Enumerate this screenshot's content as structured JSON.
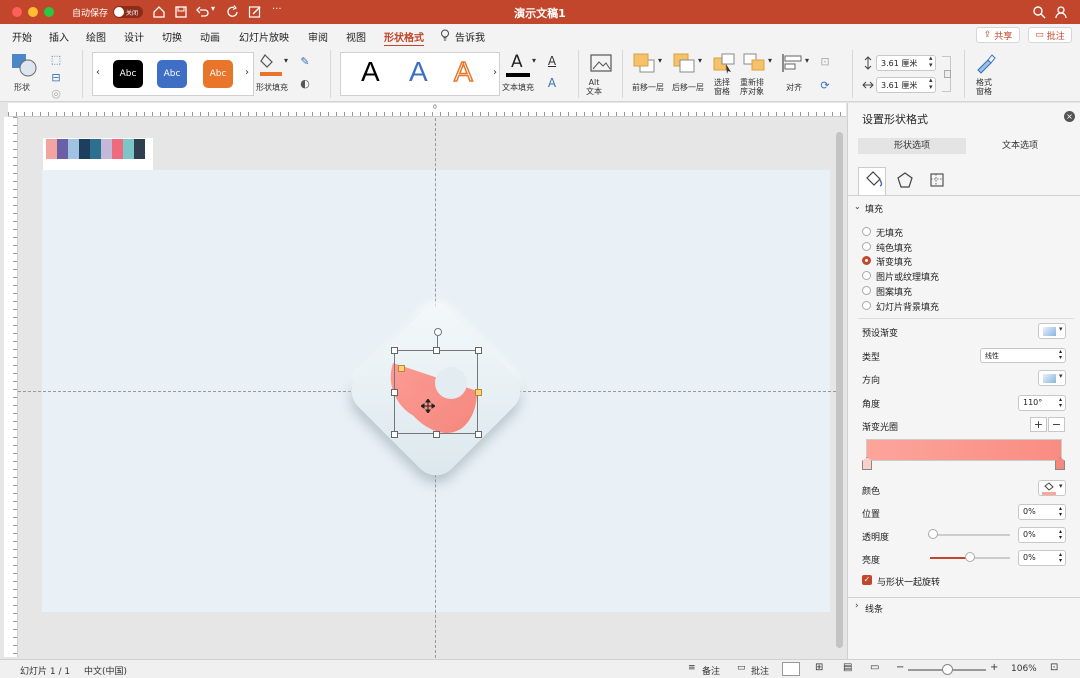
{
  "titlebar": {
    "autosave_label": "自动保存",
    "toggle_label": "关闭",
    "title": "演示文稿1"
  },
  "tabs": [
    "开始",
    "插入",
    "绘图",
    "设计",
    "切换",
    "动画",
    "幻灯片放映",
    "审阅",
    "视图",
    "形状格式",
    "告诉我"
  ],
  "active_tab": "形状格式",
  "share": {
    "share_label": "共享",
    "comments_label": "批注"
  },
  "ribbon": {
    "shapes_label": "形状",
    "style_samples": [
      "Abc",
      "Abc",
      "Abc"
    ],
    "shape_fill_label": "形状填充",
    "wordart_samples": [
      "A",
      "A",
      "A"
    ],
    "text_fill_label": "文本填充",
    "alt_text_label": "Alt\n文本",
    "bring_forward_label": "前移一层",
    "send_backward_label": "后移一层",
    "selection_pane_label": "选择\n窗格",
    "reorder_label": "重新排\n序对象",
    "align_label": "对齐",
    "height_value": "3.61 厘米",
    "width_value": "3.61 厘米",
    "format_pane_label": "格式\n窗格"
  },
  "panel": {
    "title": "设置形状格式",
    "tab_shape": "形状选项",
    "tab_text": "文本选项",
    "fill_section": "填充",
    "fill_options": [
      "无填充",
      "纯色填充",
      "渐变填充",
      "图片或纹理填充",
      "图案填充",
      "幻灯片背景填充"
    ],
    "selected_fill": "渐变填充",
    "preset_label": "预设渐变",
    "type_label": "类型",
    "type_value": "线性",
    "direction_label": "方向",
    "angle_label": "角度",
    "angle_value": "110°",
    "stops_label": "渐变光圈",
    "color_label": "颜色",
    "position_label": "位置",
    "position_value": "0%",
    "transparency_label": "透明度",
    "transparency_value": "0%",
    "brightness_label": "亮度",
    "brightness_value": "0%",
    "rotate_with_shape_label": "与形状一起旋转",
    "line_section": "线条"
  },
  "status": {
    "slide_label": "幻灯片 1 / 1",
    "language": "中文(中国)",
    "notes_label": "备注",
    "comments_label": "批注",
    "zoom": "106%"
  },
  "colors": {
    "accent": "#c2462b",
    "coral": "#f8a097",
    "slide_bg": "#e9f1f6",
    "palette": [
      "#f2a5a0",
      "#6b5fa8",
      "#9fc3e0",
      "#1f3d5c",
      "#2c6f8f",
      "#c4b8d8",
      "#ee6b7e",
      "#7cc5c8",
      "#2e3f4f"
    ]
  }
}
